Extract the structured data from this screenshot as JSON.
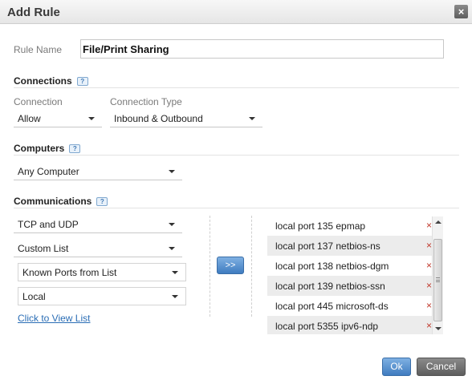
{
  "dialog": {
    "title": "Add Rule",
    "close_glyph": "×"
  },
  "rule_name": {
    "label": "Rule Name",
    "value": "File/Print Sharing"
  },
  "connections": {
    "heading": "Connections",
    "connection_label": "Connection",
    "connection_value": "Allow",
    "type_label": "Connection Type",
    "type_value": "Inbound & Outbound"
  },
  "computers": {
    "heading": "Computers",
    "value": "Any Computer"
  },
  "communications": {
    "heading": "Communications",
    "protocol_value": "TCP and UDP",
    "list_type_value": "Custom List",
    "source_value": "Known Ports from List",
    "direction_value": "Local",
    "view_list_link": "Click to View List",
    "move_button": ">>",
    "ports": [
      "local port 135 epmap",
      "local port 137 netbios-ns",
      "local port 138 netbios-dgm",
      "local port 139 netbios-ssn",
      "local port 445 microsoft-ds",
      "local port 5355 ipv6-ndp"
    ],
    "remove_glyph": "×"
  },
  "help_glyph": "?",
  "footer": {
    "ok_label": "Ok",
    "cancel_label": "Cancel"
  },
  "colors": {
    "accent": "#3f7cc0",
    "link": "#2a6db5",
    "remove": "#c0392b"
  }
}
